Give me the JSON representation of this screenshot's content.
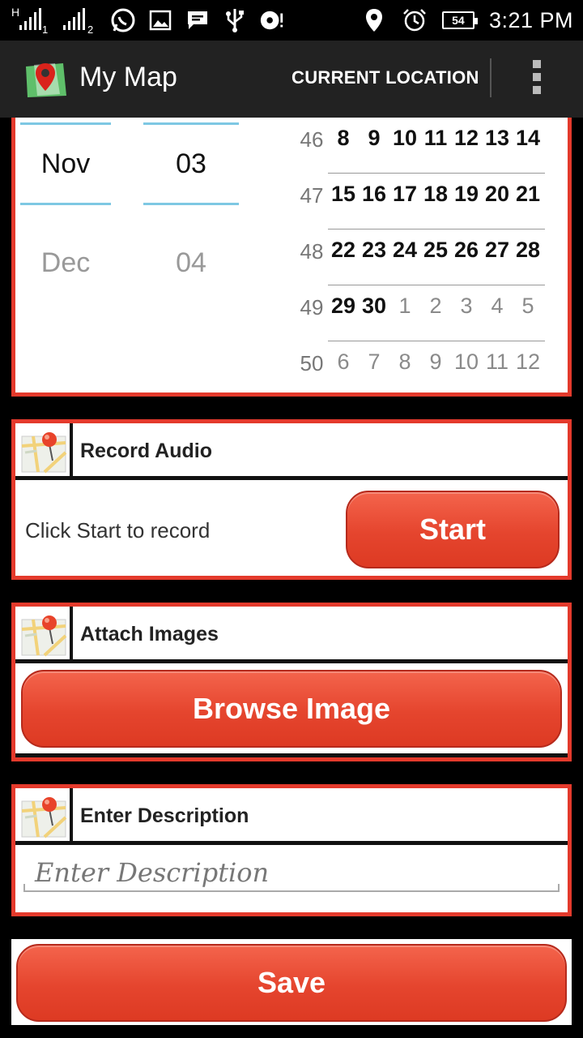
{
  "status_bar": {
    "network_type": "H",
    "sim1_label": "1",
    "sim2_label": "2",
    "battery_level": "54",
    "time": "3:21 PM",
    "icons": [
      "signal-sim1-icon",
      "signal-sim2-icon",
      "whatsapp-icon",
      "gallery-icon",
      "message-icon",
      "usb-icon",
      "sync-alert-icon",
      "location-icon",
      "alarm-icon",
      "battery-icon"
    ]
  },
  "action_bar": {
    "title": "My Map",
    "current_location_label": "CURRENT LOCATION",
    "icons": [
      "app-map-icon",
      "overflow-menu-icon"
    ]
  },
  "date_picker": {
    "month_selected": "Nov",
    "month_next": "Dec",
    "day_selected": "03",
    "day_next": "04",
    "weeks": [
      {
        "week": "46",
        "days": [
          {
            "d": "8",
            "cur": true
          },
          {
            "d": "9",
            "cur": true
          },
          {
            "d": "10",
            "cur": true
          },
          {
            "d": "11",
            "cur": true
          },
          {
            "d": "12",
            "cur": true
          },
          {
            "d": "13",
            "cur": true
          },
          {
            "d": "14",
            "cur": true
          }
        ]
      },
      {
        "week": "47",
        "days": [
          {
            "d": "15",
            "cur": true
          },
          {
            "d": "16",
            "cur": true
          },
          {
            "d": "17",
            "cur": true
          },
          {
            "d": "18",
            "cur": true
          },
          {
            "d": "19",
            "cur": true
          },
          {
            "d": "20",
            "cur": true
          },
          {
            "d": "21",
            "cur": true
          }
        ]
      },
      {
        "week": "48",
        "days": [
          {
            "d": "22",
            "cur": true
          },
          {
            "d": "23",
            "cur": true
          },
          {
            "d": "24",
            "cur": true
          },
          {
            "d": "25",
            "cur": true
          },
          {
            "d": "26",
            "cur": true
          },
          {
            "d": "27",
            "cur": true
          },
          {
            "d": "28",
            "cur": true
          }
        ]
      },
      {
        "week": "49",
        "days": [
          {
            "d": "29",
            "cur": true
          },
          {
            "d": "30",
            "cur": true
          },
          {
            "d": "1",
            "cur": false
          },
          {
            "d": "2",
            "cur": false
          },
          {
            "d": "3",
            "cur": false
          },
          {
            "d": "4",
            "cur": false
          },
          {
            "d": "5",
            "cur": false
          }
        ]
      },
      {
        "week": "50",
        "days": [
          {
            "d": "6",
            "cur": false
          },
          {
            "d": "7",
            "cur": false
          },
          {
            "d": "8",
            "cur": false
          },
          {
            "d": "9",
            "cur": false
          },
          {
            "d": "10",
            "cur": false
          },
          {
            "d": "11",
            "cur": false
          },
          {
            "d": "12",
            "cur": false
          }
        ]
      }
    ]
  },
  "record_audio": {
    "title": "Record Audio",
    "status_text": "Click Start to record",
    "start_label": "Start"
  },
  "attach_images": {
    "title": "Attach Images",
    "browse_label": "Browse Image"
  },
  "description": {
    "title": "Enter Description",
    "placeholder": "Enter Description",
    "value": ""
  },
  "save_label": "Save",
  "colors": {
    "accent_red": "#e43a2c",
    "button_red": "#e5452e",
    "picker_highlight": "#7ec8e3",
    "action_bar": "#222222"
  }
}
